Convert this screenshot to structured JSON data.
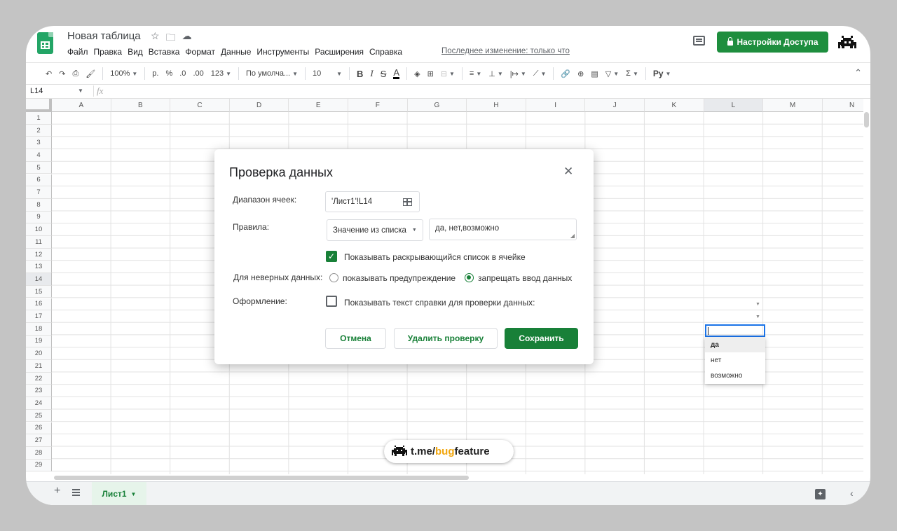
{
  "header": {
    "doc_title": "Новая таблица",
    "menu": [
      "Файл",
      "Правка",
      "Вид",
      "Вставка",
      "Формат",
      "Данные",
      "Инструменты",
      "Расширения",
      "Справка"
    ],
    "last_edit": "Последнее изменение: только что",
    "share_label": "Настройки Доступа"
  },
  "toolbar": {
    "zoom": "100%",
    "currency": "р.",
    "percent": "%",
    "dec_decrease": ".0",
    "dec_increase": ".00",
    "number_format": "123",
    "font": "По умолча...",
    "font_size": "10",
    "bold": "B",
    "italic": "I",
    "strike": "S",
    "text_color": "A",
    "sum": "Σ",
    "input_tools": "Pу"
  },
  "formula_bar": {
    "cell_ref": "L14",
    "fx": "fx"
  },
  "grid": {
    "columns": [
      "A",
      "B",
      "C",
      "D",
      "E",
      "F",
      "G",
      "H",
      "I",
      "J",
      "K",
      "L",
      "M",
      "N"
    ],
    "rows": [
      "1",
      "2",
      "3",
      "4",
      "5",
      "6",
      "7",
      "8",
      "9",
      "10",
      "11",
      "12",
      "13",
      "14",
      "15",
      "16",
      "17",
      "18",
      "19",
      "20",
      "21",
      "22",
      "23",
      "24",
      "25",
      "26",
      "27",
      "28",
      "29"
    ],
    "selected_column": "L",
    "selected_row": "14",
    "dropdown_options": [
      "да",
      "нет",
      "возможно"
    ]
  },
  "dialog": {
    "title": "Проверка данных",
    "range_label": "Диапазон ячеек:",
    "range_value": "'Лист1'!L14",
    "rules_label": "Правила:",
    "rule_type": "Значение из списка",
    "rule_values": "да, нет,возможно",
    "show_dropdown_label": "Показывать раскрывающийся список в ячейке",
    "invalid_label": "Для неверных данных:",
    "warn_option": "показывать предупреждение",
    "reject_option": "запрещать ввод данных",
    "appearance_label": "Оформление:",
    "help_text_label": "Показывать текст справки для проверки данных:",
    "cancel": "Отмена",
    "remove": "Удалить проверку",
    "save": "Сохранить"
  },
  "sheets": {
    "active": "Лист1"
  },
  "watermark": {
    "prefix": "t.me/",
    "accent": "bug",
    "suffix": "feature"
  }
}
